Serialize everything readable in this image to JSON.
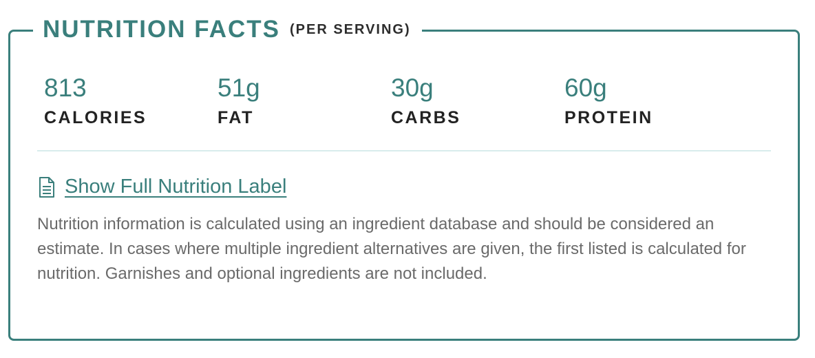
{
  "header": {
    "title": "NUTRITION FACTS",
    "subtitle": "(PER SERVING)"
  },
  "stats": [
    {
      "value": "813",
      "label": "CALORIES"
    },
    {
      "value": "51g",
      "label": "FAT"
    },
    {
      "value": "30g",
      "label": "CARBS"
    },
    {
      "value": "60g",
      "label": "PROTEIN"
    }
  ],
  "link": {
    "icon": "document-icon",
    "label": "Show Full Nutrition Label"
  },
  "disclaimer": "Nutrition information is calculated using an ingredient database and should be considered an estimate. In cases where multiple ingredient alternatives are given, the first listed is calculated for nutrition. Garnishes and optional ingredients are not included.",
  "colors": {
    "accent": "#3a7f7c",
    "text_dark": "#222222",
    "text_muted": "#6a6a6a",
    "divider": "#d8ecec"
  }
}
